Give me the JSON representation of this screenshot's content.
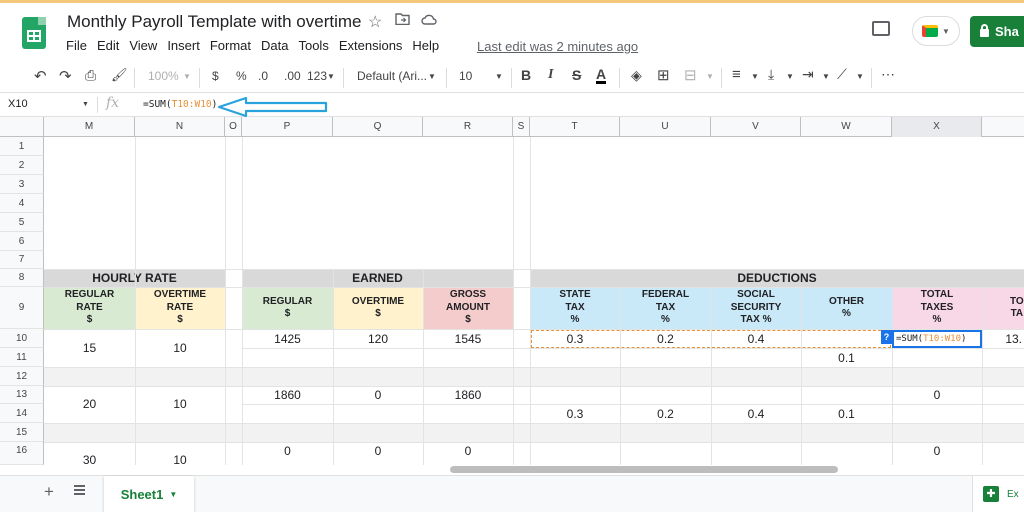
{
  "doc": {
    "title": "Monthly Payroll Template with overtime",
    "last_edit": "Last edit was 2 minutes ago",
    "share_label": "Sha"
  },
  "menu": [
    "File",
    "Edit",
    "View",
    "Insert",
    "Format",
    "Data",
    "Tools",
    "Extensions",
    "Help"
  ],
  "toolbar": {
    "zoom": "100%",
    "currency": "$",
    "percent": "%",
    "decrease_decimals": ".0",
    "increase_decimals": ".00",
    "more_formats": "123",
    "font": "Default (Ari...",
    "font_size": "10",
    "bold": "B",
    "italic": "I",
    "strikethrough": "S",
    "text_color": "A",
    "more": "⋯"
  },
  "formula_bar": {
    "name_box": "X10",
    "fx": "fx",
    "prefix": "=SUM(",
    "range": "T10:W10",
    "suffix": ")"
  },
  "columns": [
    "M",
    "N",
    "O",
    "P",
    "Q",
    "R",
    "S",
    "T",
    "U",
    "V",
    "W",
    "X"
  ],
  "rows": [
    "1",
    "2",
    "3",
    "4",
    "5",
    "6",
    "7",
    "8",
    "9",
    "10",
    "11",
    "12",
    "13",
    "14",
    "15",
    "16"
  ],
  "sections": {
    "hourly": "HOURLY RATE",
    "earned": "EARNED",
    "deductions": "DEDUCTIONS"
  },
  "headers": {
    "regular_rate": "REGULAR\nRATE\n$",
    "overtime_rate": "OVERTIME\nRATE\n$",
    "regular": "REGULAR\n$",
    "overtime": "OVERTIME\n$",
    "gross": "GROSS\nAMOUNT\n$",
    "state": "STATE\nTAX\n%",
    "federal": "FEDERAL\nTAX\n%",
    "social": "SOCIAL\nSECURITY\nTAX %",
    "other": "OTHER\n%",
    "total": "TOTAL\nTAXES\n%",
    "partial": "TO\nTA"
  },
  "data": {
    "r1": {
      "regular_rate": "15",
      "overtime_rate": "10",
      "regular": "1425",
      "overtime": "120",
      "gross": "1545",
      "state": "0.3",
      "federal": "0.2",
      "social": "0.4",
      "other": "0.1",
      "partial": "13."
    },
    "r2": {
      "regular_rate": "20",
      "overtime_rate": "10",
      "regular": "1860",
      "overtime": "0",
      "gross": "1860",
      "state": "0.3",
      "federal": "0.2",
      "social": "0.4",
      "other": "0.1",
      "total": "0"
    },
    "r3": {
      "regular_rate": "30",
      "overtime_rate": "10",
      "regular": "0",
      "overtime": "0",
      "gross": "0",
      "total": "0"
    }
  },
  "edit_cell": {
    "prefix": "=SUM(",
    "range": "T10:W10",
    "suffix": ")",
    "help": "?"
  },
  "sheets": {
    "add": "+",
    "active": "Sheet1",
    "explore": "Ex"
  }
}
